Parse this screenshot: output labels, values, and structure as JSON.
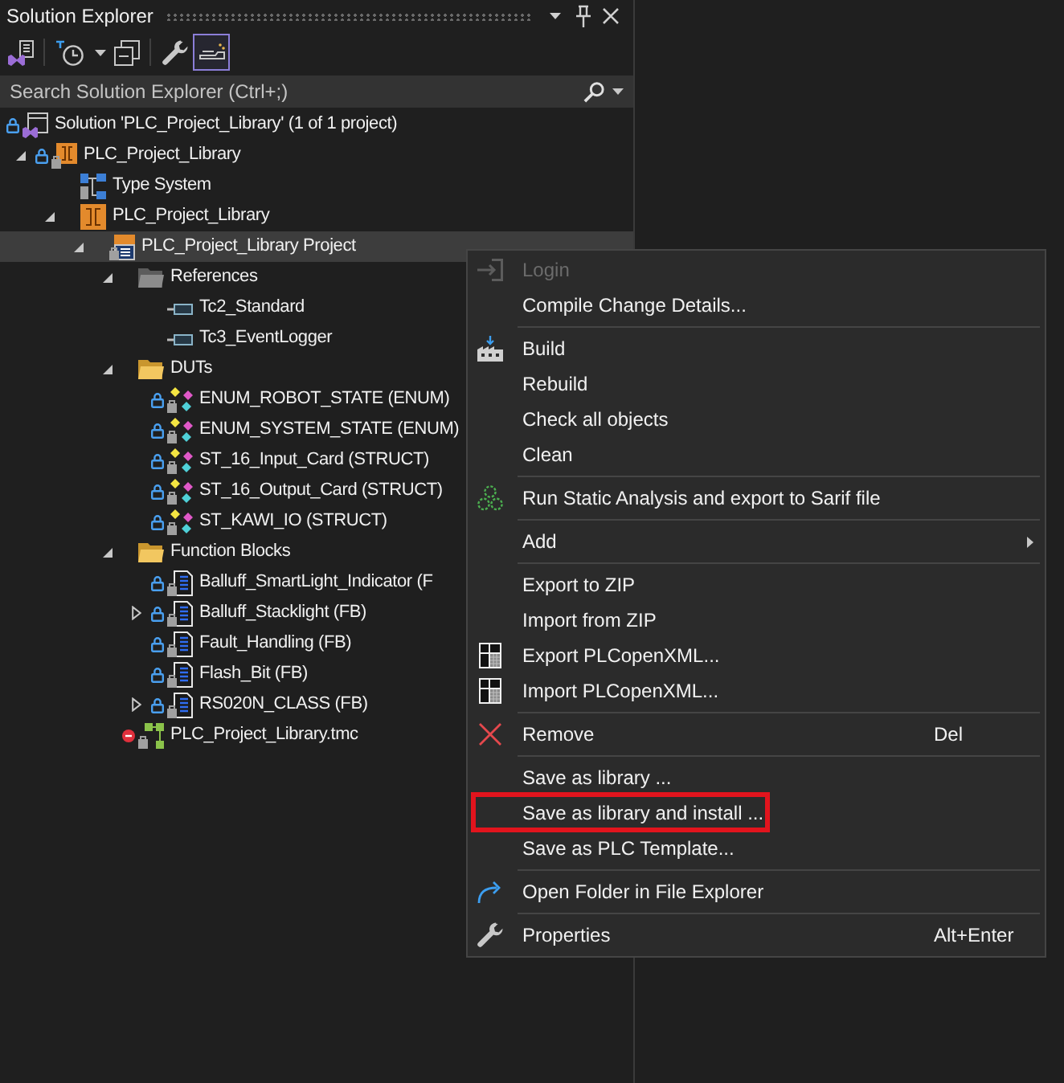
{
  "panel": {
    "title": "Solution Explorer"
  },
  "toolbar": [
    {
      "selected": false
    },
    {
      "selected": false
    },
    {
      "selected": false
    },
    {
      "selected": false
    },
    {
      "selected": true
    }
  ],
  "search": {
    "placeholder": "Search Solution Explorer (Ctrl+;)"
  },
  "tree": [
    {
      "kind": "solution",
      "label": "Solution 'PLC_Project_Library' (1 of 1 project)",
      "expandable": false,
      "locked": true,
      "flagged": false,
      "selected": false,
      "children": [
        {
          "kind": "twincat",
          "label": "PLC_Project_Library",
          "expandable": true,
          "expanded": true,
          "locked": true,
          "flagged": false,
          "selected": false,
          "children": [
            {
              "kind": "typesystem",
              "label": "Type System",
              "expandable": false,
              "locked": false,
              "flagged": false,
              "selected": false
            },
            {
              "kind": "plc",
              "label": "PLC_Project_Library",
              "expandable": true,
              "expanded": true,
              "locked": false,
              "flagged": false,
              "selected": false,
              "children": [
                {
                  "kind": "plcproject",
                  "label": "PLC_Project_Library Project",
                  "expandable": true,
                  "expanded": true,
                  "locked": false,
                  "flagged": false,
                  "selected": true,
                  "children": [
                    {
                      "kind": "references",
                      "label": "References",
                      "expandable": true,
                      "expanded": true,
                      "locked": false,
                      "flagged": false,
                      "selected": false,
                      "children": [
                        {
                          "kind": "library",
                          "label": "Tc2_Standard",
                          "expandable": false,
                          "locked": false,
                          "flagged": false,
                          "selected": false
                        },
                        {
                          "kind": "library",
                          "label": "Tc3_EventLogger",
                          "expandable": false,
                          "locked": false,
                          "flagged": false,
                          "selected": false
                        }
                      ]
                    },
                    {
                      "kind": "folder",
                      "label": "DUTs",
                      "expandable": true,
                      "expanded": true,
                      "locked": false,
                      "flagged": false,
                      "selected": false,
                      "children": [
                        {
                          "kind": "dut",
                          "label": "ENUM_ROBOT_STATE (ENUM)",
                          "expandable": false,
                          "locked": true,
                          "flagged": false,
                          "selected": false
                        },
                        {
                          "kind": "dut",
                          "label": "ENUM_SYSTEM_STATE (ENUM)",
                          "expandable": false,
                          "locked": true,
                          "flagged": false,
                          "selected": false
                        },
                        {
                          "kind": "dut",
                          "label": "ST_16_Input_Card (STRUCT)",
                          "expandable": false,
                          "locked": true,
                          "flagged": false,
                          "selected": false
                        },
                        {
                          "kind": "dut",
                          "label": "ST_16_Output_Card (STRUCT)",
                          "expandable": false,
                          "locked": true,
                          "flagged": false,
                          "selected": false
                        },
                        {
                          "kind": "dut",
                          "label": "ST_KAWI_IO (STRUCT)",
                          "expandable": false,
                          "locked": true,
                          "flagged": false,
                          "selected": false
                        }
                      ]
                    },
                    {
                      "kind": "folder",
                      "label": "Function Blocks",
                      "expandable": true,
                      "expanded": true,
                      "locked": false,
                      "flagged": false,
                      "selected": false,
                      "children": [
                        {
                          "kind": "fb",
                          "label": "Balluff_SmartLight_Indicator (F",
                          "expandable": false,
                          "locked": true,
                          "flagged": false,
                          "selected": false
                        },
                        {
                          "kind": "fb",
                          "label": "Balluff_Stacklight (FB)",
                          "expandable": true,
                          "expanded": false,
                          "locked": true,
                          "flagged": false,
                          "selected": false
                        },
                        {
                          "kind": "fb",
                          "label": "Fault_Handling (FB)",
                          "expandable": false,
                          "locked": true,
                          "flagged": false,
                          "selected": false
                        },
                        {
                          "kind": "fb",
                          "label": "Flash_Bit (FB)",
                          "expandable": false,
                          "locked": true,
                          "flagged": false,
                          "selected": false
                        },
                        {
                          "kind": "fb",
                          "label": "RS020N_CLASS (FB)",
                          "expandable": true,
                          "expanded": false,
                          "locked": true,
                          "flagged": false,
                          "selected": false
                        }
                      ]
                    },
                    {
                      "kind": "tmc",
                      "label": "PLC_Project_Library.tmc",
                      "expandable": false,
                      "locked": false,
                      "flagged": true,
                      "selected": false
                    }
                  ]
                }
              ]
            }
          ]
        }
      ]
    }
  ],
  "context_menu": {
    "groups": [
      {
        "items": [
          {
            "kind": "command",
            "label": "Login",
            "disabled": true,
            "outlined": false
          },
          {
            "kind": "command",
            "label": "Compile Change Details...",
            "disabled": false,
            "outlined": false
          }
        ]
      },
      {
        "items": [
          {
            "kind": "command",
            "label": "Build",
            "disabled": false,
            "outlined": false
          },
          {
            "kind": "command",
            "label": "Rebuild",
            "disabled": false,
            "outlined": false
          },
          {
            "kind": "command",
            "label": "Check all objects",
            "disabled": false,
            "outlined": false
          },
          {
            "kind": "command",
            "label": "Clean",
            "disabled": false,
            "outlined": false
          }
        ]
      },
      {
        "items": [
          {
            "kind": "command",
            "label": "Run Static Analysis and export to Sarif file",
            "disabled": false,
            "outlined": false
          }
        ]
      },
      {
        "items": [
          {
            "kind": "submenu",
            "label": "Add",
            "disabled": false,
            "outlined": false
          }
        ]
      },
      {
        "items": [
          {
            "kind": "command",
            "label": "Export to ZIP",
            "disabled": false,
            "outlined": false
          },
          {
            "kind": "command",
            "label": "Import from ZIP",
            "disabled": false,
            "outlined": false
          },
          {
            "kind": "command",
            "label": "Export PLCopenXML...",
            "disabled": false,
            "outlined": false
          },
          {
            "kind": "command",
            "label": "Import PLCopenXML...",
            "disabled": false,
            "outlined": false
          }
        ]
      },
      {
        "items": [
          {
            "kind": "command",
            "label": "Remove",
            "shortcut": "Del",
            "disabled": false,
            "outlined": false
          }
        ]
      },
      {
        "items": [
          {
            "kind": "command",
            "label": "Save as library ...",
            "disabled": false,
            "outlined": false
          },
          {
            "kind": "command",
            "label": "Save as library and install ...",
            "disabled": false,
            "outlined": true
          },
          {
            "kind": "command",
            "label": "Save as PLC Template...",
            "disabled": false,
            "outlined": false
          }
        ]
      },
      {
        "items": [
          {
            "kind": "command",
            "label": "Open Folder in File Explorer",
            "disabled": false,
            "outlined": false
          }
        ]
      },
      {
        "items": [
          {
            "kind": "command",
            "label": "Properties",
            "shortcut": "Alt+Enter",
            "disabled": false,
            "outlined": false
          }
        ]
      }
    ]
  }
}
